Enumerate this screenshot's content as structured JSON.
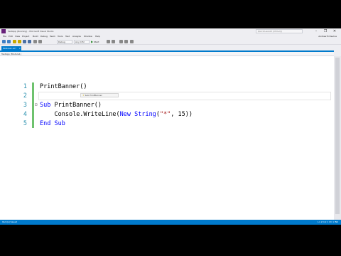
{
  "window": {
    "title": "TestApp (Running) - Microsoft Visual Studio",
    "quick_launch_placeholder": "Quick Launch (Ctrl+Q)",
    "minimize": "–",
    "restore": "❐",
    "close": "✕",
    "accent": "#007acc"
  },
  "menu": {
    "items": [
      "File",
      "Edit",
      "View",
      "Project",
      "Build",
      "Debug",
      "Team",
      "Tools",
      "Test",
      "Analyze",
      "Window",
      "Help"
    ],
    "account": "Andrew B Devine"
  },
  "toolbar": {
    "config": "Debug",
    "platform": "Any CPU",
    "start_label": "Start"
  },
  "tabs": {
    "active": "Module1.vb*",
    "close_glyph": "×"
  },
  "navbar": {
    "scope": "TestApp (Module1)"
  },
  "editor": {
    "line_numbers": [
      "1",
      "2",
      "3",
      "4",
      "5"
    ],
    "line1": "PrintBanner()",
    "line3_kw": "Sub",
    "line3_rest": " PrintBanner()",
    "line4_indent": "    ",
    "line4_a": "Console.WriteLine(",
    "line4_kw": "New",
    "line4_b": " ",
    "line4_kw2": "String",
    "line4_c": "(",
    "line4_str": "\"*\"",
    "line4_d": ", 15))",
    "line5_kw": "End Sub",
    "fold_glyph": "⊟",
    "lightbulb_text": "Sub PrintBanner"
  },
  "status": {
    "left": "Item(s) Saved",
    "right": "Ln 2  Col 1  Ch 1  INS"
  }
}
